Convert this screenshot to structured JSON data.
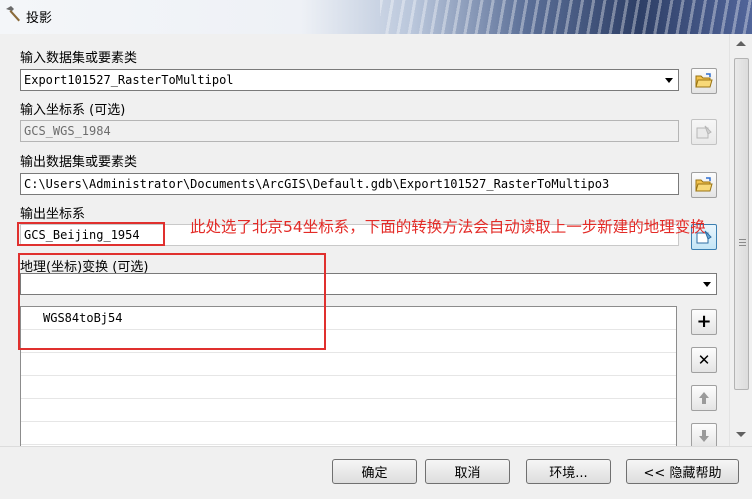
{
  "window": {
    "title": "投影"
  },
  "input_dataset": {
    "label": "输入数据集或要素类",
    "value": "Export101527_RasterToMultipol"
  },
  "input_crs": {
    "label": "输入坐标系 (可选)",
    "value": "GCS_WGS_1984"
  },
  "output_dataset": {
    "label": "输出数据集或要素类",
    "value": "C:\\Users\\Administrator\\Documents\\ArcGIS\\Default.gdb\\Export101527_RasterToMultipo3"
  },
  "output_crs": {
    "label": "输出坐标系",
    "value": "GCS_Beijing_1954"
  },
  "transform": {
    "label": "地理(坐标)变换 (可选)",
    "dropdown_value": "",
    "items": [
      "WGS84toBj54",
      "",
      "",
      "",
      "",
      ""
    ]
  },
  "annotation": {
    "text": "此处选了北京54坐标系，下面的转换方法会自动读取上一步新建的地理变换"
  },
  "buttons": {
    "ok": "确定",
    "cancel": "取消",
    "environments": "环境...",
    "hide_help": "<< 隐藏帮助"
  },
  "colors": {
    "annotation": "#e32b27",
    "highlight_border": "#e0302e"
  },
  "icons": {
    "title": "hammer-icon",
    "browse": "folder-open-icon",
    "crs_properties": "crs-properties-icon",
    "add": "plus-icon",
    "remove": "x-icon",
    "move_up": "arrow-up-icon",
    "move_down": "arrow-down-icon"
  }
}
